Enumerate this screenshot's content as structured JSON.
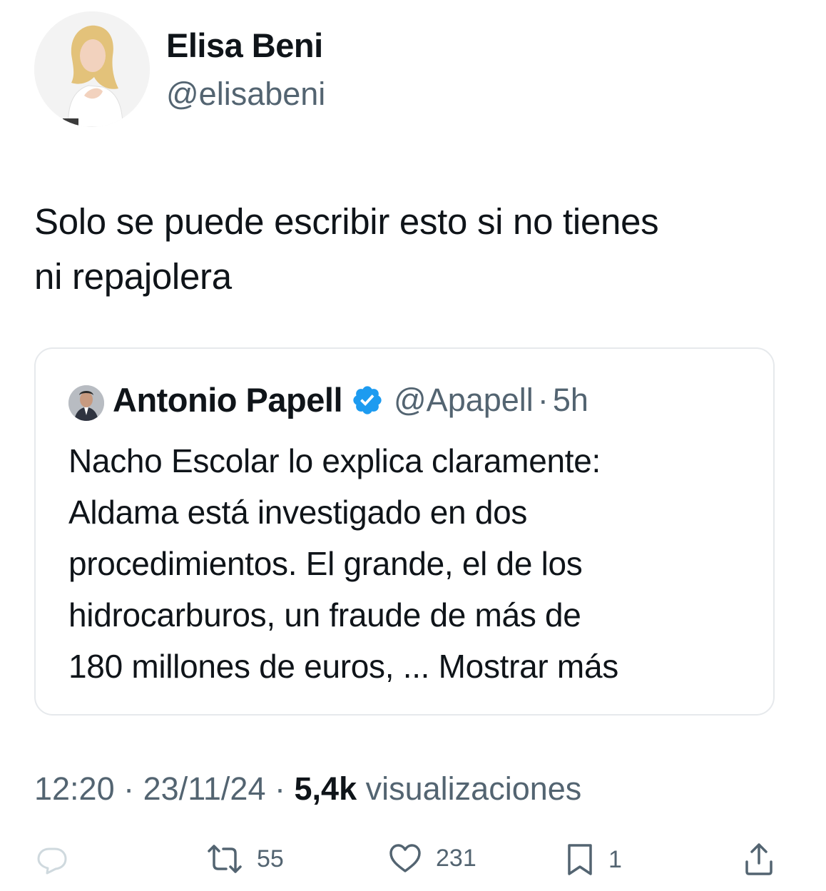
{
  "author": {
    "name": "Elisa Beni",
    "handle": "@elisabeni",
    "avatar_icon": "profile-photo"
  },
  "tweet": {
    "text_lines": [
      "Solo se puede escribir esto si no tienes",
      "ni repajolera"
    ]
  },
  "quoted": {
    "name": "Antonio Papell",
    "handle": "@Apapell",
    "separator": "·",
    "time": "5h",
    "verified_color": "#1d9bf0",
    "text_lines": [
      "Nacho Escolar lo explica claramente:",
      "Aldama está investigado en dos",
      "procedimientos. El grande, el de los",
      "hidrocarburos, un fraude de más de",
      "180 millones de euros, ..."
    ],
    "show_more": "Mostrar más"
  },
  "meta": {
    "time": "12:20",
    "sep1": "·",
    "date": "23/11/24",
    "sep2": "·",
    "views_count": "5,4k",
    "views_label": "visualizaciones"
  },
  "actions": {
    "reply": {
      "icon": "reply-icon"
    },
    "retweet": {
      "icon": "retweet-icon",
      "count": "55"
    },
    "like": {
      "icon": "heart-icon",
      "count": "231"
    },
    "bookmark": {
      "icon": "bookmark-icon",
      "count": "1"
    },
    "share": {
      "icon": "share-icon"
    }
  },
  "colors": {
    "text": "#0f1419",
    "secondary": "#536471",
    "border": "#e6e9ec",
    "verified": "#1d9bf0"
  }
}
